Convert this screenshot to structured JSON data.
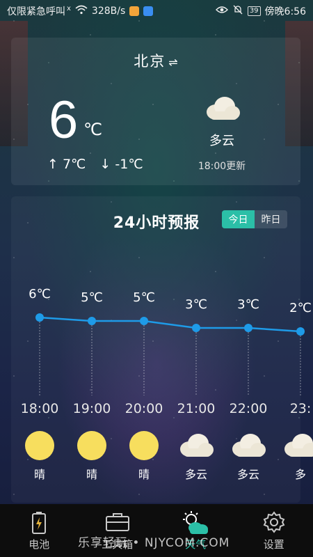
{
  "status_bar": {
    "carrier": "仅限紧急呼叫",
    "signal_mark": "x",
    "net_speed": "328B/s",
    "battery": "39",
    "time": "傍晚6:56"
  },
  "location": {
    "city": "北京",
    "swap_icon": "swap-arrows-icon"
  },
  "current": {
    "temp": "6",
    "unit": "℃",
    "high": "7℃",
    "low": "-1℃",
    "condition": "多云",
    "updated": "18:00更新"
  },
  "forecast": {
    "title": "24小时预报",
    "tabs": [
      {
        "label": "今日",
        "active": true
      },
      {
        "label": "昨日",
        "active": false
      }
    ]
  },
  "chart_data": {
    "type": "line",
    "x": [
      "18:00",
      "19:00",
      "20:00",
      "21:00",
      "22:00",
      "23:"
    ],
    "series": [
      {
        "values": [
          6,
          5,
          5,
          3,
          3,
          2
        ]
      }
    ],
    "value_labels": [
      "6℃",
      "5℃",
      "5℃",
      "3℃",
      "3℃",
      "2℃"
    ],
    "conditions": [
      "晴",
      "晴",
      "晴",
      "多云",
      "多云",
      "多"
    ],
    "icons": [
      "sun-icon",
      "sun-icon",
      "sun-icon",
      "cloud-icon",
      "cloud-icon",
      "cloud-icon"
    ],
    "line_color": "#1e9be8"
  },
  "nav": {
    "items": [
      {
        "label": "电池",
        "icon": "battery-icon",
        "active": false
      },
      {
        "label": "工具箱",
        "icon": "toolbox-icon",
        "active": false
      },
      {
        "label": "天气",
        "icon": "weather-icon",
        "active": true
      },
      {
        "label": "设置",
        "icon": "gear-icon",
        "active": false
      }
    ]
  },
  "watermark": "乐享轻玩 • NJYCOM.COM"
}
